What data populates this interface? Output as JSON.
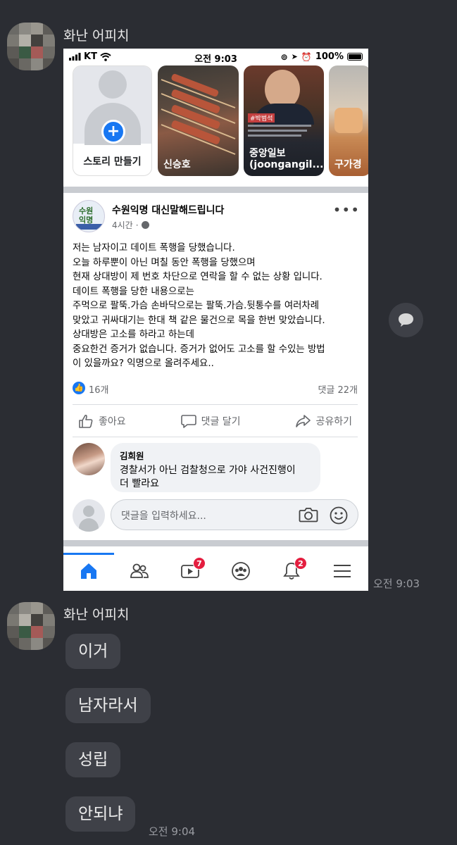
{
  "chat": {
    "sender_name": "화난 어피치",
    "time_first": "오전 9:03",
    "time_last": "오전 9:04",
    "messages": [
      "이거",
      "남자라서",
      "성립",
      "안되냐"
    ]
  },
  "screenshot": {
    "status": {
      "carrier": "KT",
      "time": "오전 9:03",
      "battery": "100%"
    },
    "stories": [
      {
        "label": "스토리 만들기"
      },
      {
        "label": "신승호"
      },
      {
        "label": "중앙일보 (joongangil..."
      },
      {
        "label": "구가경"
      }
    ],
    "story3_caption": "#박범석",
    "post": {
      "page_name": "수원익명 대신말해드립니다",
      "page_logo_text": [
        "수원",
        "익명"
      ],
      "time": "4시간",
      "body_lines": [
        "저는 남자이고 데이트 폭행을 당했습니다.",
        "오늘 하루뿐이 아닌 며칠 동안 폭행을 당했으며",
        "현재 상대방이 제 번호 차단으로 연락을 할 수 없는 상황 입니다.",
        "데이트 폭행을 당한 내용으로는",
        "주먹으로 팔뚝.가슴  손바닥으로는 팔뚝.가슴.뒷통수를 여러차례",
        "맞았고 귀싸대기는 한대 책 같은 물건으로 목을 한번 맞았습니다.",
        "상대방은 고소를 하라고 하는데",
        "중요한건 증거가 없습니다. 증거가 없어도 고소를 할 수있는 방법",
        "이 있을까요? 익명으로 올려주세요.."
      ],
      "likes": "16개",
      "comments": "댓글 22개",
      "actions": {
        "like": "좋아요",
        "comment": "댓글 달기",
        "share": "공유하기"
      }
    },
    "comment": {
      "author": "김희원",
      "text_line1": "경찰서가 아닌 검찰청으로 가야 사건진행이",
      "text_line2": "더 빨라요"
    },
    "comment_input": {
      "placeholder": "댓글을 입력하세요..."
    },
    "tabbar": {
      "video_badge": "7",
      "notif_badge": "2"
    }
  },
  "colors": {
    "chat_bg": "#2b2d33",
    "bubble": "#3f4148",
    "facebook_blue": "#1877f2",
    "badge_red": "#e41e3f"
  }
}
